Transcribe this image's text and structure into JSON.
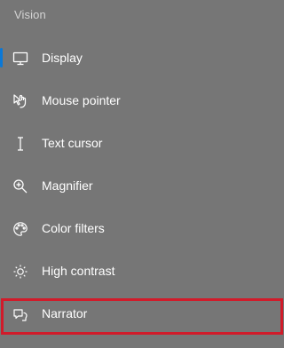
{
  "section": {
    "heading": "Vision"
  },
  "items": [
    {
      "label": "Display",
      "icon": "monitor-icon",
      "selected": true
    },
    {
      "label": "Mouse pointer",
      "icon": "mouse-pointer-icon",
      "selected": false
    },
    {
      "label": "Text cursor",
      "icon": "text-cursor-icon",
      "selected": false
    },
    {
      "label": "Magnifier",
      "icon": "magnifier-icon",
      "selected": false
    },
    {
      "label": "Color filters",
      "icon": "color-palette-icon",
      "selected": false
    },
    {
      "label": "High contrast",
      "icon": "brightness-icon",
      "selected": false
    },
    {
      "label": "Narrator",
      "icon": "narrator-icon",
      "selected": false
    }
  ],
  "colors": {
    "background": "#767676",
    "accent": "#0a78d7",
    "highlight": "#d11b2a"
  }
}
